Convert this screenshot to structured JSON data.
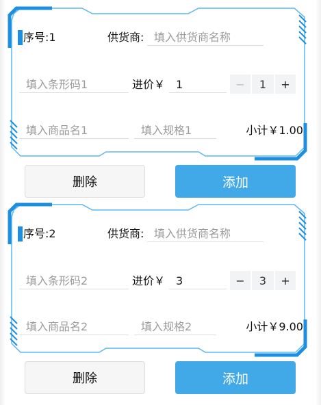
{
  "colors": {
    "frame": "#1e8fe0",
    "add_button": "#41a9e8",
    "stepper_bg": "#f2f3f5"
  },
  "items": [
    {
      "seq_label": "序号:1",
      "supplier_label": "供货商:",
      "supplier_placeholder": "填入供货商名称",
      "barcode_placeholder": "填入条形码1",
      "price_label": "进价￥",
      "price_value": "1",
      "qty_minus": "−",
      "qty_value": "1",
      "qty_plus": "+",
      "name_placeholder": "填入商品名1",
      "spec_placeholder": "填入规格1",
      "subtotal": "小计￥1.00",
      "delete_label": "删除",
      "add_label": "添加"
    },
    {
      "seq_label": "序号:2",
      "supplier_label": "供货商:",
      "supplier_placeholder": "填入供货商名称",
      "barcode_placeholder": "填入条形码2",
      "price_label": "进价￥",
      "price_value": "3",
      "qty_minus": "−",
      "qty_value": "3",
      "qty_plus": "+",
      "name_placeholder": "填入商品名2",
      "spec_placeholder": "填入规格2",
      "subtotal": "小计￥9.00",
      "delete_label": "删除",
      "add_label": "添加"
    }
  ]
}
